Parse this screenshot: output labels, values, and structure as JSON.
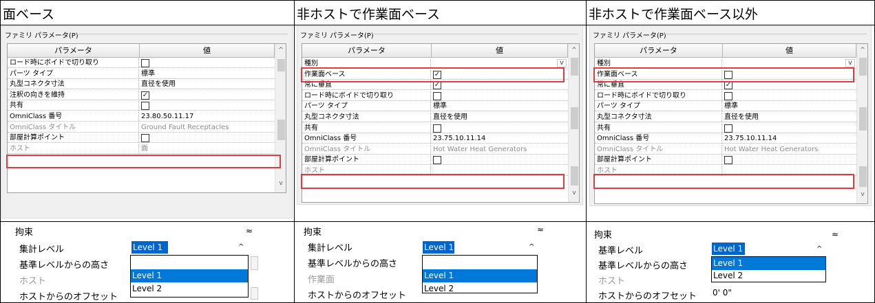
{
  "columns": [
    {
      "title": "面ベース"
    },
    {
      "title": "非ホストで作業面ベース"
    },
    {
      "title": "非ホストで作業面ベース以外"
    }
  ],
  "dialog": {
    "group_label": "ファミリ パラメータ(P)",
    "header_param": "パラメータ",
    "header_value": "値",
    "scroll_up": "^",
    "scroll_down": "v"
  },
  "panel1": {
    "rows": [
      {
        "label": "ロード時にボイドで切り取り",
        "value": "",
        "checkbox": "empty"
      },
      {
        "label": "パーツ タイプ",
        "value": "標準"
      },
      {
        "label": "丸型コネクタ寸法",
        "value": "直径を使用"
      },
      {
        "label": "注釈の向きを維持",
        "value": "",
        "checkbox": "checked"
      },
      {
        "label": "共有",
        "value": "",
        "checkbox": "empty"
      },
      {
        "label": "OmniClass 番号",
        "value": "23.80.50.11.17"
      },
      {
        "label": "OmniClass タイトル",
        "value": "Ground Fault Receptacles",
        "gray": true
      },
      {
        "label": "部屋計算ポイント",
        "value": "",
        "checkbox": "empty"
      },
      {
        "label": "ホスト",
        "value": "面",
        "gray": true
      }
    ]
  },
  "panel2": {
    "rows": [
      {
        "label": "種別",
        "value": "",
        "dropdown": true
      },
      {
        "label": "作業面ベース",
        "value": "",
        "checkbox": "checked"
      },
      {
        "label": "常に垂直",
        "value": "",
        "checkbox": "checked"
      },
      {
        "label": "ロード時にボイドで切り取り",
        "value": "",
        "checkbox": "empty"
      },
      {
        "label": "パーツ タイプ",
        "value": "標準"
      },
      {
        "label": "丸型コネクタ寸法",
        "value": "直径を使用"
      },
      {
        "label": "共有",
        "value": "",
        "checkbox": "empty"
      },
      {
        "label": "OmniClass 番号",
        "value": "23.75.10.11.14"
      },
      {
        "label": "OmniClass タイトル",
        "value": "Hot Water Heat Generators",
        "gray": true
      },
      {
        "label": "部屋計算ポイント",
        "value": "",
        "checkbox": "empty"
      },
      {
        "label": "ホスト",
        "value": "",
        "gray": true
      }
    ]
  },
  "panel3": {
    "rows": [
      {
        "label": "種別",
        "value": "",
        "dropdown": true
      },
      {
        "label": "作業面ベース",
        "value": "",
        "checkbox": "empty"
      },
      {
        "label": "常に垂直",
        "value": "",
        "checkbox": "checked"
      },
      {
        "label": "ロード時にボイドで切り取り",
        "value": "",
        "checkbox": "empty"
      },
      {
        "label": "パーツ タイプ",
        "value": "標準"
      },
      {
        "label": "丸型コネクタ寸法",
        "value": "直径を使用"
      },
      {
        "label": "共有",
        "value": "",
        "checkbox": "empty"
      },
      {
        "label": "OmniClass 番号",
        "value": "23.75.10.11.14"
      },
      {
        "label": "OmniClass タイトル",
        "value": "Hot Water Heat Generators",
        "gray": true
      },
      {
        "label": "部屋計算ポイント",
        "value": "",
        "checkbox": "empty"
      },
      {
        "label": "ホスト",
        "value": "",
        "gray": true
      }
    ]
  },
  "props1": {
    "section": "拘束",
    "collapse": "≈",
    "labels": [
      {
        "text": "集計レベル"
      },
      {
        "text": "基準レベルからの高さ"
      },
      {
        "text": "ホスト",
        "gray": true
      },
      {
        "text": "ホストからのオフセット"
      }
    ],
    "selected": "Level 1",
    "options": [
      {
        "text": "Level 1",
        "selected": true
      },
      {
        "text": "Level 2"
      }
    ]
  },
  "props2": {
    "section": "拘束",
    "collapse": "≈",
    "labels": [
      {
        "text": "集計レベル"
      },
      {
        "text": "基準レベルからの高さ"
      },
      {
        "text": "作業面",
        "gray": true
      },
      {
        "text": "ホストからのオフセット"
      }
    ],
    "selected": "Level 1",
    "options": [
      {
        "text": "Level 1",
        "selected": true
      },
      {
        "text": "Level 2"
      }
    ]
  },
  "props3": {
    "section": "拘束",
    "collapse": "≈",
    "labels": [
      {
        "text": "基準レベル"
      },
      {
        "text": "基準レベルからの高さ"
      },
      {
        "text": "ホスト",
        "gray": true
      },
      {
        "text": "ホストからのオフセット"
      }
    ],
    "selected": "Level 1",
    "options": [
      {
        "text": "Level 1",
        "selected": true
      },
      {
        "text": "Level 2"
      }
    ],
    "offset_value": "0'  0\""
  },
  "colors": {
    "highlight": "#e03c3c",
    "selection": "#0078d7"
  }
}
